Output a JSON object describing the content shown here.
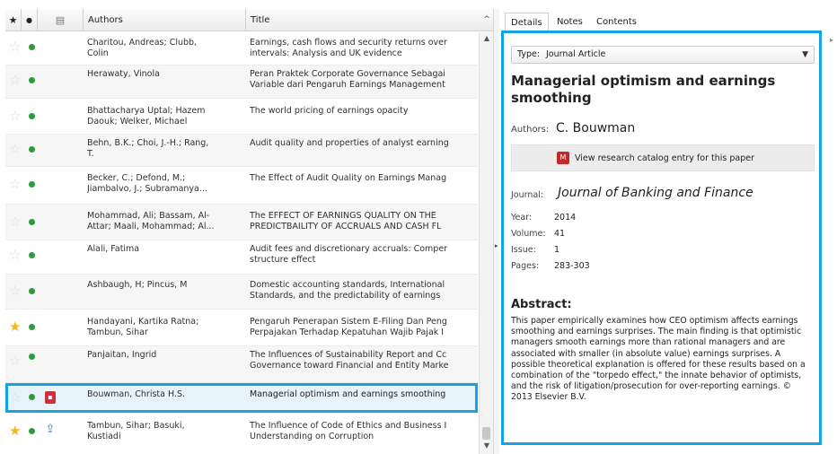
{
  "list": {
    "columns": {
      "favorite_icon": "★",
      "read_icon": "●",
      "file_icon": "▤",
      "authors": "Authors",
      "title": "Title",
      "sort_indicator": "^"
    },
    "rows": [
      {
        "authors": "Charitou, Andreas; Clubb,\nColin",
        "title": "Earnings, cash flows and security returns over\nintervals: Analysis and UK evidence",
        "starred": false,
        "file": ""
      },
      {
        "authors": "Herawaty, Vinola",
        "title": "Peran Praktek Corporate Governance Sebagai\nVariable dari Pengaruh Earnings Management",
        "starred": false,
        "file": ""
      },
      {
        "authors": "Bhattacharya Uptal; Hazem\nDaouk; Welker, Michael",
        "title": "The world pricing of earnings opacity",
        "starred": false,
        "file": ""
      },
      {
        "authors": "Behn, B.K.; Choi, J.-H.; Rang,\nT.",
        "title": "Audit quality and properties of analyst earning",
        "starred": false,
        "file": ""
      },
      {
        "authors": "Becker, C.; Defond, M.;\nJiambalvo, J.; Subramanya...",
        "title": "The Effect of Audit Quality on Earnings Manag",
        "starred": false,
        "file": ""
      },
      {
        "authors": "Mohammad, Ali; Bassam, Al-\nAttar; Maali, Mohammad; Al...",
        "title": "The EFFECT OF EARNINGS QUALITY ON THE\nPREDICTBAILITY OF ACCRUALS AND CASH FL",
        "starred": false,
        "file": ""
      },
      {
        "authors": "Alali, Fatima",
        "title": "Audit fees and discretionary accruals: Comper\nstructure effect",
        "starred": false,
        "file": ""
      },
      {
        "authors": "Ashbaugh, H; Pincus, M",
        "title": "Domestic accounting standards, International\nStandards, and the predictability of earnings",
        "starred": false,
        "file": ""
      },
      {
        "authors": "Handayani, Kartika Ratna;\nTambun, Sihar",
        "title": "Pengaruh Penerapan Sistem E-Filing Dan Peng\nPerpajakan Terhadap Kepatuhan Wajib Pajak I",
        "starred": true,
        "file": ""
      },
      {
        "authors": "Panjaitan, Ingrid",
        "title": "The Influences of Sustainability Report and Cc\nGovernance toward Financial and Entity Marke",
        "starred": false,
        "file": ""
      },
      {
        "authors": "Bouwman, Christa H.S.",
        "title": "Managerial optimism and earnings smoothing",
        "starred": false,
        "file": "pdf-icon"
      },
      {
        "authors": "Tambun, Sihar; Basuki,\nKustiadi",
        "title": "The Influence of Code of Ethics and Business I\nUnderstanding on Corruption",
        "starred": true,
        "file": "upload-icon"
      }
    ]
  },
  "tabs": [
    "Details",
    "Notes",
    "Contents"
  ],
  "details": {
    "type_label": "Type:",
    "type_value": "Journal Article",
    "title": "Managerial optimism and earnings smoothing",
    "authors_label": "Authors:",
    "authors_value": "C. Bouwman",
    "catalog_link": "View research catalog entry for this paper",
    "journal_label": "Journal:",
    "journal_value": "Journal of Banking and Finance",
    "year_label": "Year:",
    "year_value": "2014",
    "volume_label": "Volume:",
    "volume_value": "41",
    "issue_label": "Issue:",
    "issue_value": "1",
    "pages_label": "Pages:",
    "pages_value": "283-303",
    "abstract_heading": "Abstract:",
    "abstract_text": "This paper empirically examines how CEO optimism affects earnings smoothing and earnings surprises. The main finding is that optimistic managers smooth earnings more than rational managers and are associated with smaller (in absolute value) earnings surprises. A possible theoretical explanation is offered for these results based on a combination of the \"torpedo effect,\" the innate behavior of optimists, and the risk of litigation/prosecution for over-reporting earnings. © 2013 Elsevier B.V."
  },
  "colors": {
    "highlight": "#12a4e3",
    "read_dot": "#2e9a3a",
    "star_on": "#f3b61f",
    "pdf": "#d0303b"
  }
}
